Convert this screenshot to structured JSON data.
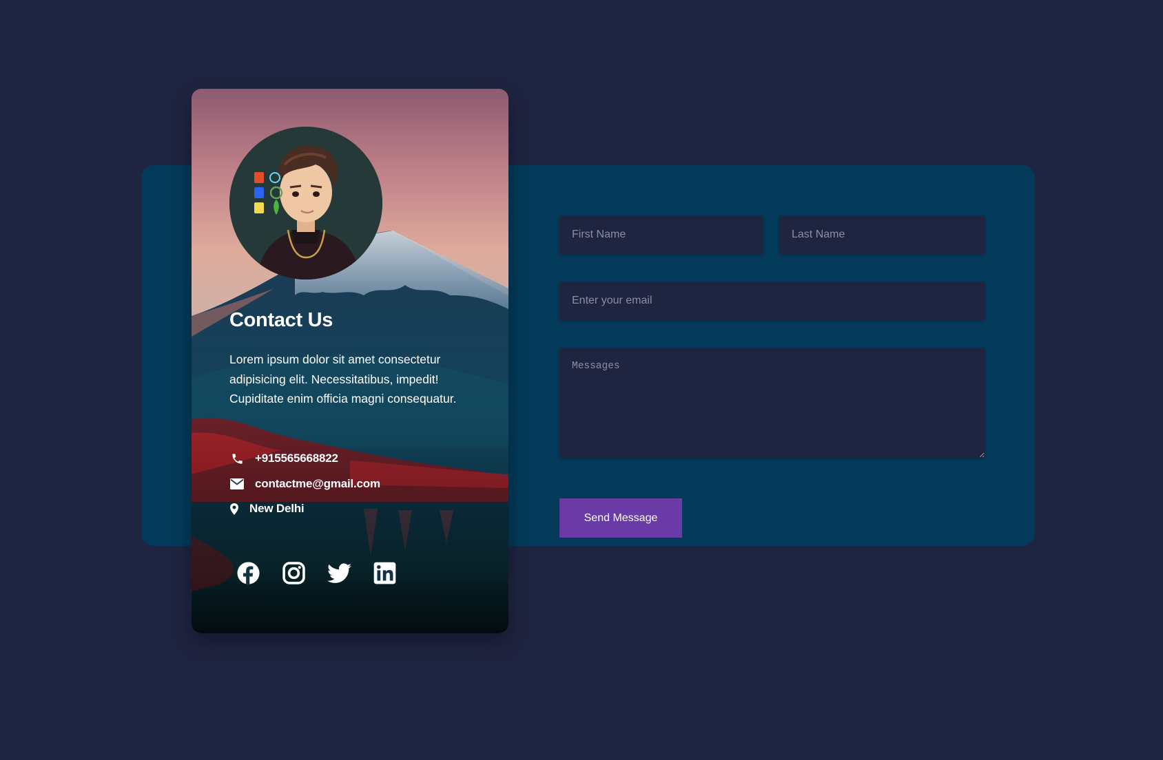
{
  "card": {
    "title": "Contact Us",
    "description": "Lorem ipsum dolor sit amet consectetur adipisicing elit. Necessitatibus, impedit! Cupiditate enim officia magni consequatur.",
    "phone": "+915565668822",
    "email": "contactme@gmail.com",
    "location": "New Delhi",
    "socials": [
      "facebook-icon",
      "instagram-icon",
      "twitter-icon",
      "linkedin-icon"
    ]
  },
  "form": {
    "first_name_placeholder": "First Name",
    "last_name_placeholder": "Last Name",
    "email_placeholder": "Enter your email",
    "message_placeholder": "Messages",
    "submit_label": "Send Message"
  },
  "colors": {
    "page_bg": "#1f2441",
    "panel_bg": "#033a59",
    "field_bg": "#1f2441",
    "button_bg": "#6a3aa7",
    "text": "#ffffff"
  }
}
